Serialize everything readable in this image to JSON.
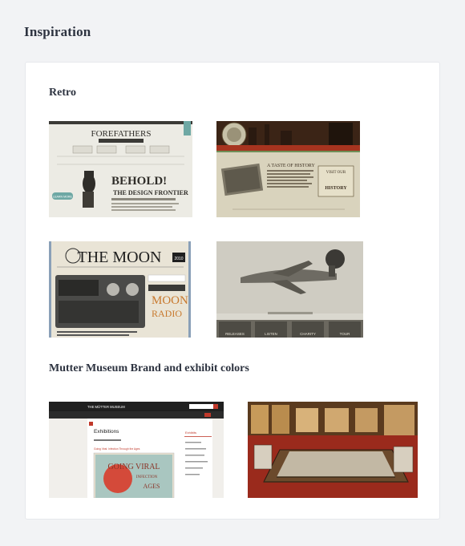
{
  "page": {
    "title": "Inspiration"
  },
  "sections": [
    {
      "title": "Retro",
      "thumbs": [
        {
          "name": "Forefathers retro site",
          "headline": "FOREFATHERS",
          "big": "BEHOLD!",
          "sub": "THE DESIGN FRONTIER",
          "button": "LEARN MORE"
        },
        {
          "name": "Vintage history site",
          "headline": "A TASTE OF HISTORY",
          "badge": "VISIT OUR",
          "badge2": "HISTORY"
        },
        {
          "name": "The Moon radio site",
          "headline": "THE MOON",
          "year": "2010",
          "big": "MOON",
          "big2": "RADIO"
        },
        {
          "name": "Airplane retro site",
          "nav": [
            "RELEASES",
            "LISTEN",
            "CHARITY",
            "TOUR"
          ]
        }
      ]
    },
    {
      "title": "Mutter Museum Brand and exhibit colors",
      "thumbs": [
        {
          "name": "Mutter Museum exhibitions page",
          "brand": "THE MÜTTER MUSEUM",
          "heading": "Exhibitions",
          "side": "Exhibits",
          "exhibit": "Going Viral: Infection Through the Ages",
          "poster": "GOING VIRAL",
          "poster2": "INFECTION",
          "poster3": "AGES"
        },
        {
          "name": "Mutter Museum exhibit hall photo"
        }
      ]
    }
  ]
}
